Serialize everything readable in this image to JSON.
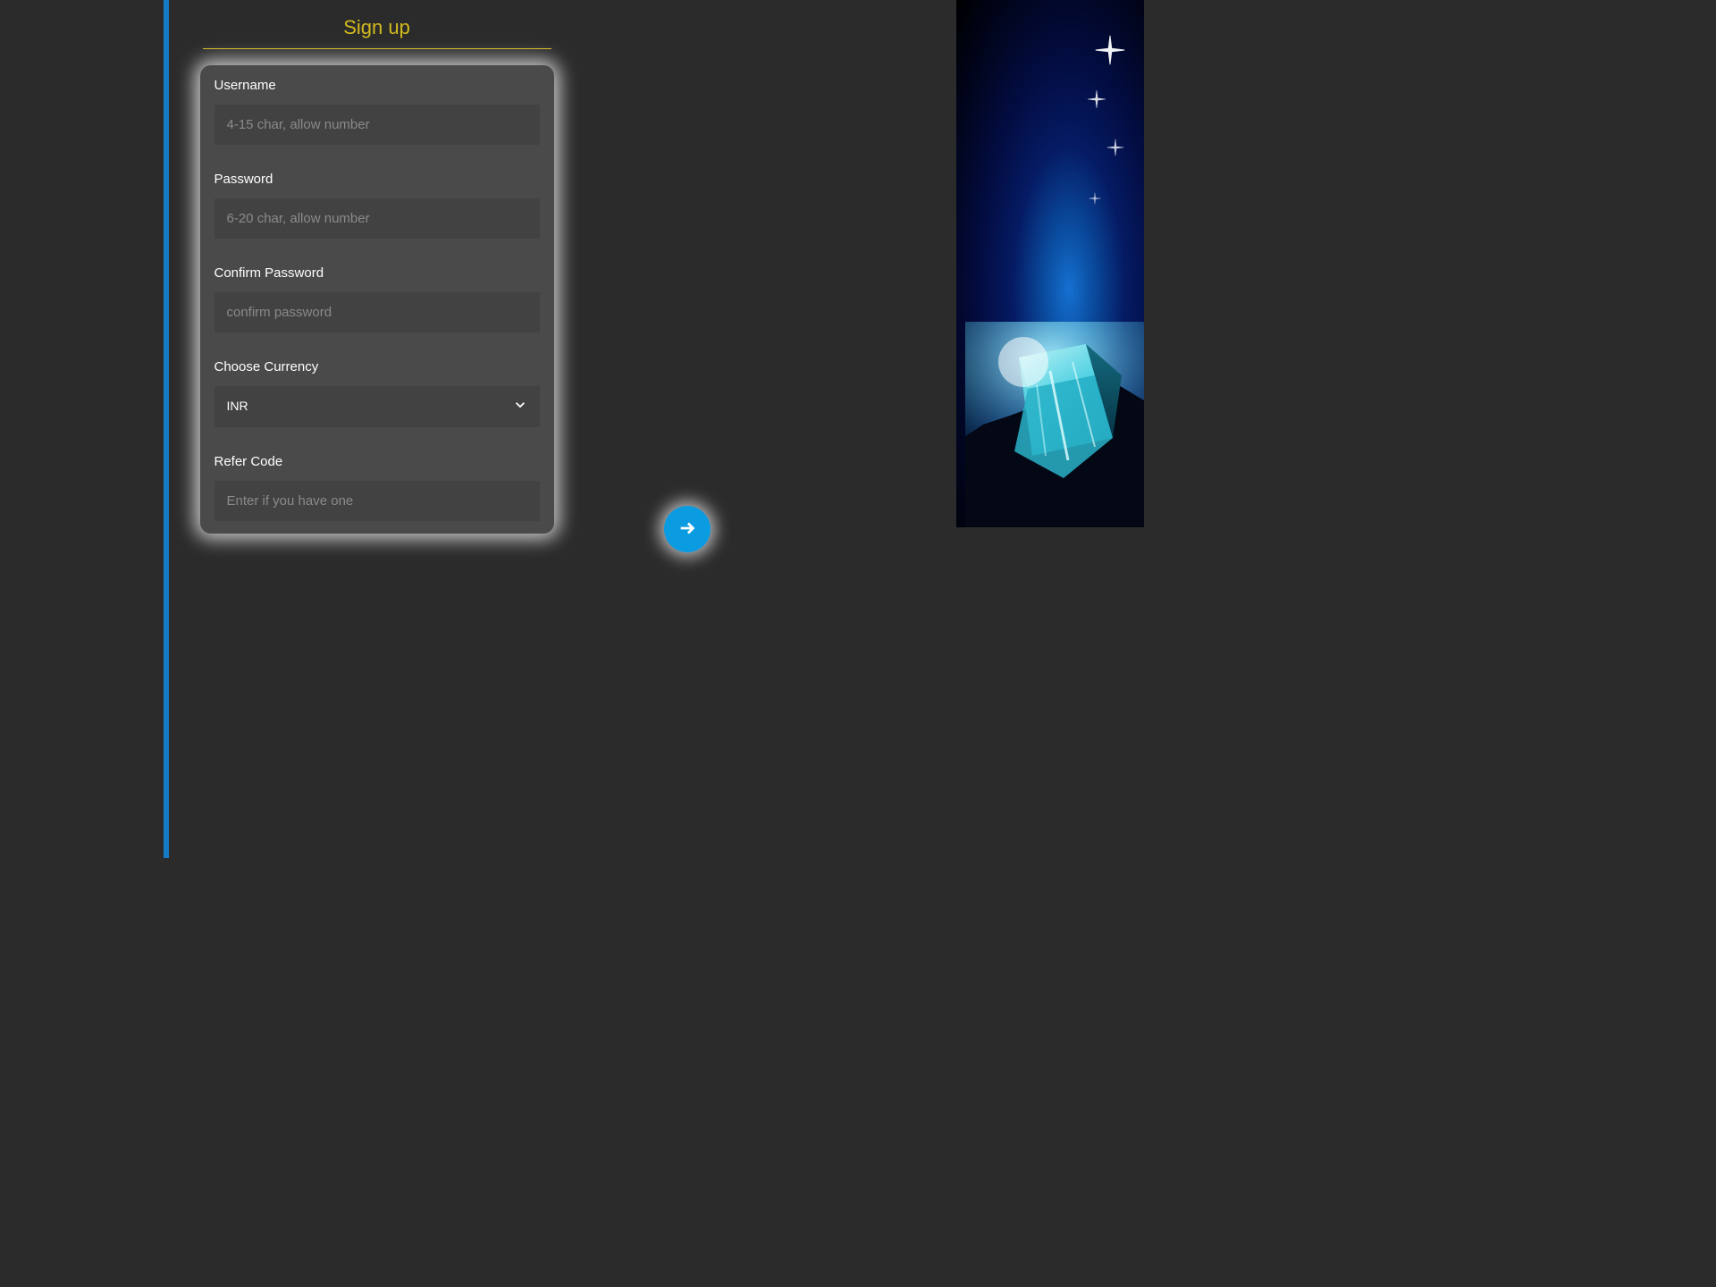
{
  "page_title": "Sign up",
  "form": {
    "username": {
      "label": "Username",
      "placeholder": "4-15 char, allow number",
      "value": ""
    },
    "password": {
      "label": "Password",
      "placeholder": "6-20 char, allow number",
      "value": ""
    },
    "confirm_password": {
      "label": "Confirm Password",
      "placeholder": "confirm password",
      "value": ""
    },
    "currency": {
      "label": "Choose Currency",
      "selected": "INR"
    },
    "refer_code": {
      "label": "Refer Code",
      "placeholder": "Enter if you have one",
      "value": ""
    }
  }
}
